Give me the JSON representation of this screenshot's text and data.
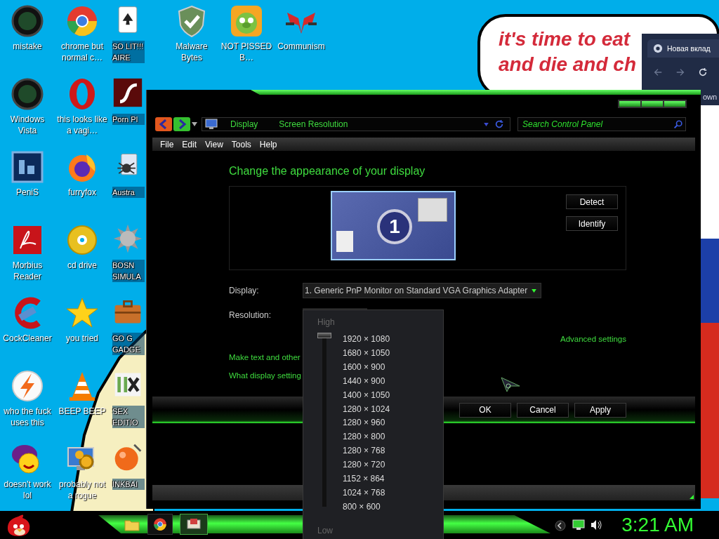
{
  "desktop": {
    "icon_columns": [
      [
        {
          "label": "mistake",
          "kind": "orb"
        },
        {
          "label": "Windows Vista",
          "kind": "orb"
        },
        {
          "label": "PeniS",
          "kind": "ps"
        },
        {
          "label": "Morbius Reader",
          "kind": "pdf"
        },
        {
          "label": "CockCleaner",
          "kind": "cleaner"
        },
        {
          "label": "who the fuck uses this",
          "kind": "bolt"
        },
        {
          "label": "doesn't work lol",
          "kind": "yahoo"
        }
      ],
      [
        {
          "label": "chrome but normal c…",
          "kind": "chrome"
        },
        {
          "label": "this looks like a vagi…",
          "kind": "ring"
        },
        {
          "label": "furryfox",
          "kind": "fox"
        },
        {
          "label": "cd drive",
          "kind": "disc"
        },
        {
          "label": "you tried",
          "kind": "star"
        },
        {
          "label": "BEEP BEEP",
          "kind": "cone"
        },
        {
          "label": "probably not a rogue",
          "kind": "gears"
        }
      ],
      [
        {
          "label": "SO LIT!!! AIRE",
          "kind": "card"
        },
        {
          "label": "Porn Pl",
          "kind": "flash"
        },
        {
          "label": "Austra",
          "kind": "spider"
        },
        {
          "label": "BOSN SIMULA",
          "kind": "mine"
        },
        {
          "label": "GO G GADGE",
          "kind": "briefcase"
        },
        {
          "label": "SEX EDITIO",
          "kind": "tile"
        },
        {
          "label": "INKBAI",
          "kind": "ball"
        }
      ],
      [
        {
          "label": "Malware Bytes",
          "kind": "shield"
        }
      ],
      [
        {
          "label": "NOT PISSED B…",
          "kind": "pig"
        }
      ],
      [
        {
          "label": "Communism",
          "kind": "emblem"
        }
      ]
    ]
  },
  "speech_bubble": {
    "lines": [
      "it's time to eat",
      "and die and ch"
    ]
  },
  "browser_window": {
    "tab_title": "Новая вклад",
    "page_text": "own"
  },
  "window": {
    "breadcrumbs": [
      "Display",
      "Screen Resolution"
    ],
    "search": {
      "placeholder": "Search Control Panel"
    },
    "menu": [
      "File",
      "Edit",
      "View",
      "Tools",
      "Help"
    ],
    "heading": "Change the appearance of your display",
    "preview": {
      "monitor_number": "1",
      "buttons": [
        "Detect",
        "Identify"
      ]
    },
    "display": {
      "label": "Display:",
      "value": "1. Generic PnP Monitor on Standard VGA Graphics Adapter"
    },
    "resolution": {
      "label": "Resolution:",
      "popup": {
        "high_label": "High",
        "low_label": "Low",
        "level": 1,
        "options": [
          "1920 × 1080",
          "1680 × 1050",
          "1600 × 900",
          "1440 × 900",
          "1400 × 1050",
          "1280 × 1024",
          "1280 × 960",
          "1280 × 800",
          "1280 × 768",
          "1280 × 720",
          "1152 × 864",
          "1024 × 768",
          "800 × 600"
        ]
      }
    },
    "advanced_link": "Advanced settings",
    "links": [
      "Make text and other",
      "What display setting"
    ],
    "buttons": [
      "OK",
      "Cancel",
      "Apply"
    ]
  },
  "taskbar": {
    "clock": "3:21 AM"
  }
}
